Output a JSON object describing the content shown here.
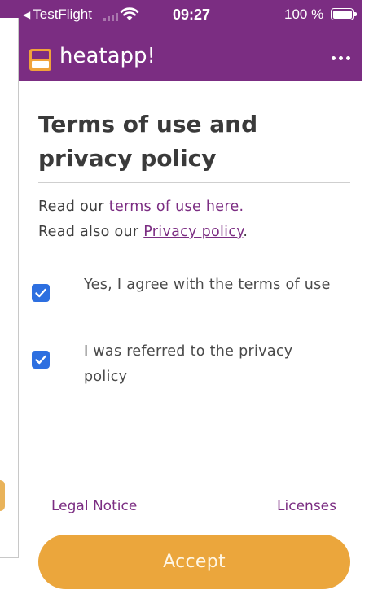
{
  "status_bar": {
    "back_label": "TestFlight",
    "time": "09:27",
    "battery_percent": "100 %",
    "battery_level": 1.0,
    "icons": [
      "back-triangle-icon",
      "signal-icon",
      "wifi-icon",
      "battery-icon"
    ]
  },
  "app_bar": {
    "app_name": "heatapp!",
    "logo_icon": "heatapp-logo-icon",
    "menu_icon": "more-dots-icon"
  },
  "page": {
    "title": "Terms of use and privacy policy",
    "terms_prefix": "Read our ",
    "terms_link": "terms of use here.",
    "privacy_prefix": "Read also our ",
    "privacy_link": "Privacy policy",
    "privacy_suffix": "."
  },
  "checkboxes": [
    {
      "label": "Yes, I agree with the terms of use",
      "checked": true
    },
    {
      "label": "I was referred to the privacy policy",
      "checked": true
    }
  ],
  "footer": {
    "legal_notice": "Legal Notice",
    "licenses": "Licenses",
    "accept_label": "Accept"
  },
  "colors": {
    "brand_purple": "#7b2d82",
    "accept_orange": "#eba63c",
    "checkbox_blue": "#2d6fe0"
  }
}
